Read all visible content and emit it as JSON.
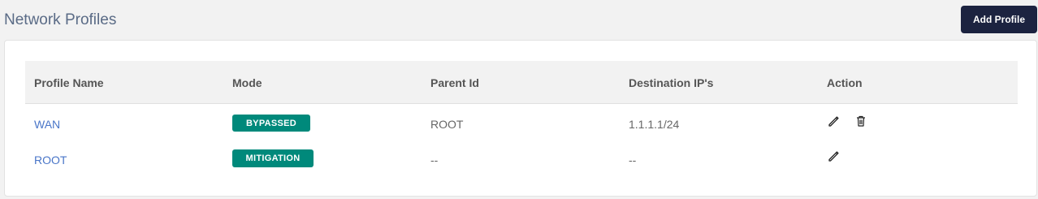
{
  "header": {
    "title": "Network Profiles",
    "add_button_label": "Add Profile"
  },
  "table": {
    "columns": [
      "Profile Name",
      "Mode",
      "Parent Id",
      "Destination IP's",
      "Action"
    ],
    "rows": [
      {
        "profile_name": "WAN",
        "mode": "BYPASSED",
        "parent_id": "ROOT",
        "destination_ips": "1.1.1.1/24",
        "actions": [
          "pencil-icon",
          "trash-icon"
        ]
      },
      {
        "profile_name": "ROOT",
        "mode": "MITIGATION",
        "parent_id": "--",
        "destination_ips": "--",
        "actions": [
          "pencil-icon"
        ]
      }
    ]
  },
  "colors": {
    "accent": "#1c2340",
    "badge": "#00897b",
    "link": "#4a76c8"
  }
}
